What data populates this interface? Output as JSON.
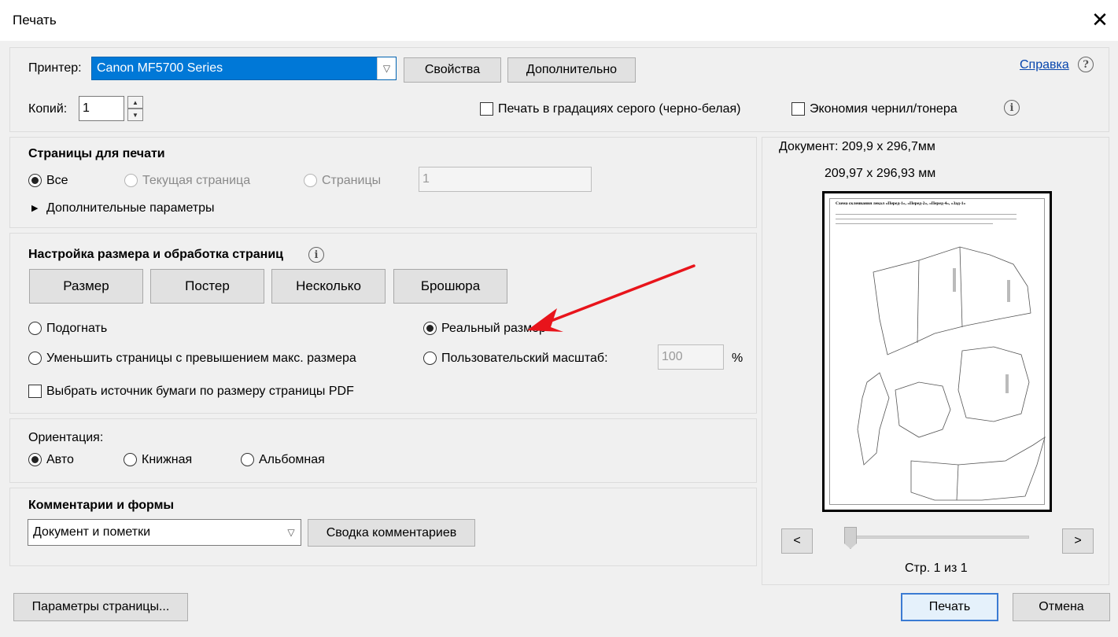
{
  "window": {
    "title": "Печать"
  },
  "printer": {
    "label": "Принтер:",
    "value": "Canon MF5700 Series",
    "properties_button": "Свойства",
    "advanced_button": "Дополнительно",
    "help_link": "Справка",
    "copies_label": "Копий:",
    "copies_value": "1",
    "grayscale_label": "Печать в градациях серого (черно-белая)",
    "save_ink_label": "Экономия чернил/тонера"
  },
  "pages": {
    "heading": "Страницы для печати",
    "all": "Все",
    "current": "Текущая страница",
    "pages": "Страницы",
    "pages_value": "1",
    "more_options": "Дополнительные параметры"
  },
  "sizing": {
    "heading": "Настройка размера и обработка страниц",
    "size_button": "Размер",
    "poster_button": "Постер",
    "multiple_button": "Несколько",
    "booklet_button": "Брошюра",
    "fit": "Подогнать",
    "actual_size": "Реальный размер",
    "shrink": "Уменьшить страницы с превышением макс. размера",
    "custom_scale": "Пользовательский масштаб:",
    "custom_scale_value": "100",
    "percent": "%",
    "paper_source": "Выбрать источник бумаги по размеру страницы PDF"
  },
  "orientation": {
    "heading": "Ориентация:",
    "auto": "Авто",
    "portrait": "Книжная",
    "landscape": "Альбомная"
  },
  "comments": {
    "heading": "Комментарии и формы",
    "value": "Документ и пометки",
    "summary_button": "Сводка комментариев"
  },
  "preview": {
    "document_size": "Документ: 209,9 x 296,7мм",
    "paper_size": "209,97 x 296,93 мм",
    "doc_title": "Схема склеивания лекал «Перед-1», «Перед-2», «Перед-4», «Зад-1»",
    "prev": "<",
    "next": ">",
    "page_info": "Стр. 1 из 1"
  },
  "footer": {
    "page_setup": "Параметры страницы...",
    "print": "Печать",
    "cancel": "Отмена"
  },
  "colors": {
    "selection": "#0078d7",
    "arrow": "#e8141b",
    "link": "#0645ad"
  }
}
